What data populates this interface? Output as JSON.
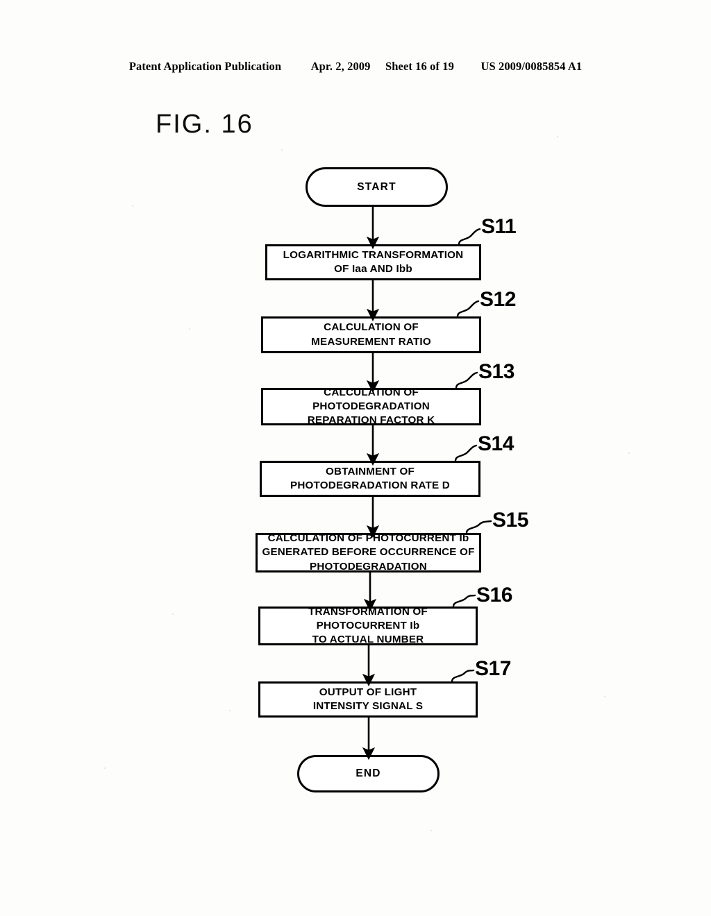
{
  "header": {
    "publication": "Patent Application Publication",
    "date": "Apr. 2, 2009",
    "sheet": "Sheet 16 of 19",
    "doc_number": "US 2009/0085854 A1"
  },
  "figure": {
    "title": "FIG. 16"
  },
  "flowchart": {
    "start_label": "START",
    "end_label": "END",
    "steps": [
      {
        "id": "S11",
        "text": "LOGARITHMIC TRANSFORMATION\nOF Iaa AND Ibb"
      },
      {
        "id": "S12",
        "text": "CALCULATION OF\nMEASUREMENT RATIO"
      },
      {
        "id": "S13",
        "text": "CALCULATION OF\nPHOTODEGRADATION\nREPARATION FACTOR K"
      },
      {
        "id": "S14",
        "text": "OBTAINMENT OF\nPHOTODEGRADATION RATE D"
      },
      {
        "id": "S15",
        "text": "CALCULATION OF PHOTOCURRENT Ib\nGENERATED BEFORE OCCURRENCE OF\nPHOTODEGRADATION"
      },
      {
        "id": "S16",
        "text": "TRANSFORMATION OF\nPHOTOCURRENT Ib\nTO ACTUAL NUMBER"
      },
      {
        "id": "S17",
        "text": "OUTPUT OF LIGHT\nINTENSITY SIGNAL S"
      }
    ]
  },
  "colors": {
    "ink": "#000000",
    "paper": "#fdfdfc"
  }
}
